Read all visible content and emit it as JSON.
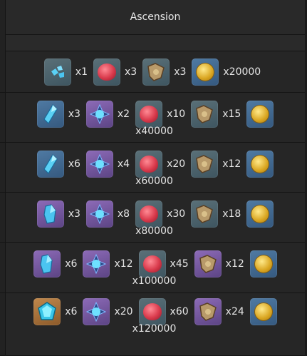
{
  "header": {
    "title": "Ascension"
  },
  "rows": [
    {
      "items": [
        {
          "icon": "crystal-sliver-icon",
          "rarity": "r2",
          "qty": "x1"
        },
        {
          "icon": "red-fruit-icon",
          "rarity": "r2",
          "qty": "x3"
        },
        {
          "icon": "ornament-icon",
          "rarity": "r2",
          "qty": "x3"
        },
        {
          "icon": "mora-coin-icon",
          "rarity": "mora",
          "qty": "x20000"
        }
      ]
    },
    {
      "items": [
        {
          "icon": "crystal-fragment-icon",
          "rarity": "r3",
          "qty": "x3"
        },
        {
          "icon": "crystal-core-icon",
          "rarity": "r4",
          "qty": "x2"
        },
        {
          "icon": "red-fruit-icon",
          "rarity": "r2",
          "qty": "x10"
        },
        {
          "icon": "ornament-icon",
          "rarity": "r2",
          "qty": "x15"
        },
        {
          "icon": "mora-coin-icon",
          "rarity": "mora",
          "qty": "x40000"
        }
      ]
    },
    {
      "items": [
        {
          "icon": "crystal-fragment-icon",
          "rarity": "r3",
          "qty": "x6"
        },
        {
          "icon": "crystal-core-icon",
          "rarity": "r4",
          "qty": "x4"
        },
        {
          "icon": "red-fruit-icon",
          "rarity": "r2",
          "qty": "x20"
        },
        {
          "icon": "ornament-icon",
          "rarity": "r2",
          "qty": "x12"
        },
        {
          "icon": "mora-coin-icon",
          "rarity": "mora",
          "qty": "x60000"
        }
      ]
    },
    {
      "items": [
        {
          "icon": "crystal-chunk-icon",
          "rarity": "r4",
          "qty": "x3"
        },
        {
          "icon": "crystal-core-icon",
          "rarity": "r4",
          "qty": "x8"
        },
        {
          "icon": "red-fruit-icon",
          "rarity": "r2",
          "qty": "x30"
        },
        {
          "icon": "ornament-icon",
          "rarity": "r2",
          "qty": "x18"
        },
        {
          "icon": "mora-coin-icon",
          "rarity": "mora",
          "qty": "x80000"
        }
      ]
    },
    {
      "items": [
        {
          "icon": "crystal-chunk-icon",
          "rarity": "r4",
          "qty": "x6"
        },
        {
          "icon": "crystal-core-icon",
          "rarity": "r4",
          "qty": "x12"
        },
        {
          "icon": "red-fruit-icon",
          "rarity": "r2",
          "qty": "x45"
        },
        {
          "icon": "ornament-icon",
          "rarity": "r4",
          "qty": "x12"
        },
        {
          "icon": "mora-coin-icon",
          "rarity": "mora",
          "qty": "x100000"
        }
      ]
    },
    {
      "items": [
        {
          "icon": "crystal-gemstone-icon",
          "rarity": "r5",
          "qty": "x6"
        },
        {
          "icon": "crystal-core-icon",
          "rarity": "r4",
          "qty": "x20"
        },
        {
          "icon": "red-fruit-icon",
          "rarity": "r2",
          "qty": "x60"
        },
        {
          "icon": "ornament-icon",
          "rarity": "r4",
          "qty": "x24"
        },
        {
          "icon": "mora-coin-icon",
          "rarity": "mora",
          "qty": "x120000"
        }
      ]
    }
  ]
}
